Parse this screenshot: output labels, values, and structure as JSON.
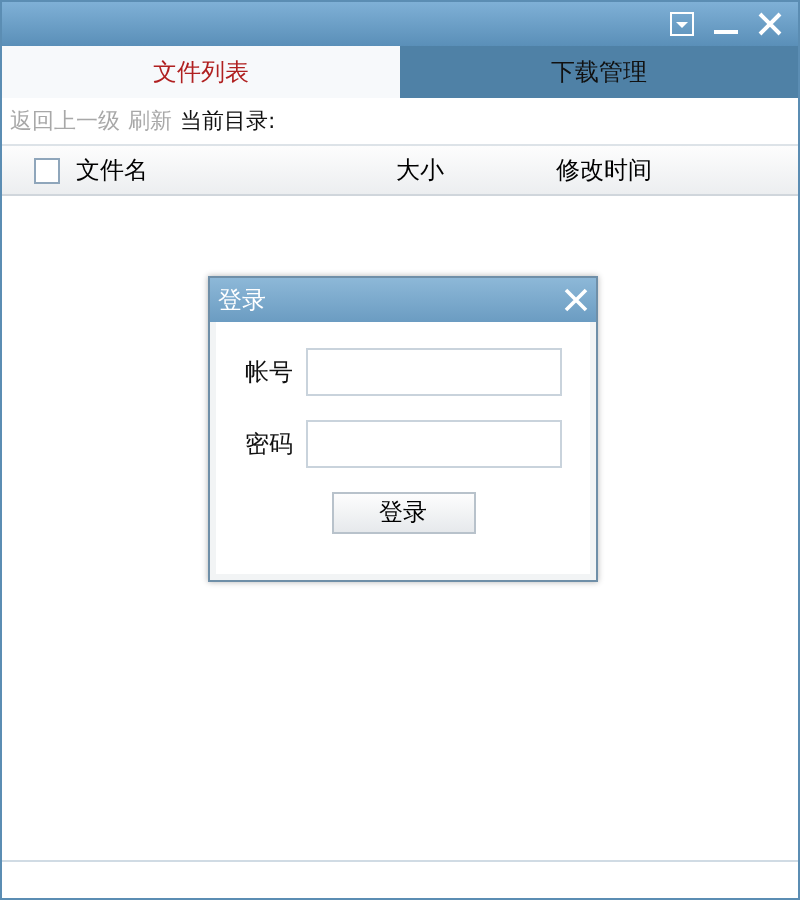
{
  "tabs": [
    {
      "label": "文件列表",
      "selected": true
    },
    {
      "label": "下载管理",
      "selected": false
    }
  ],
  "toolbar": {
    "actions": [
      {
        "label": "返回上一级",
        "disabled": true
      },
      {
        "label": "刷新",
        "disabled": true
      }
    ],
    "path_label": "当前目录:"
  },
  "table": {
    "select_all": {
      "checked": false
    },
    "columns": [
      "文件名",
      "大小",
      "修改时间"
    ]
  },
  "dialog": {
    "title": "登录",
    "fields": [
      {
        "label": "帐号"
      },
      {
        "label": "密码"
      }
    ],
    "button": "登录"
  }
}
